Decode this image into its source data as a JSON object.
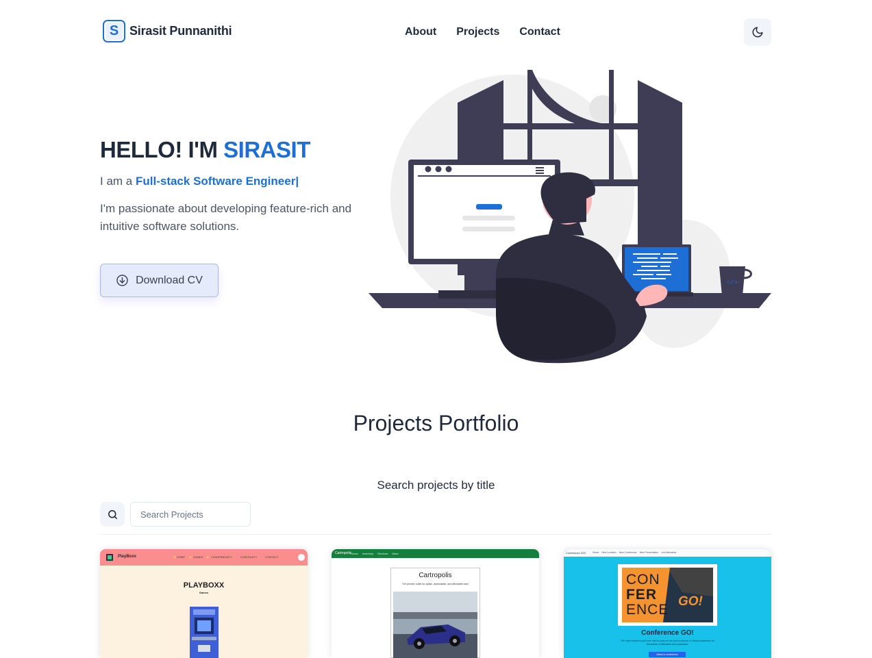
{
  "brand": {
    "logo_letter": "S",
    "name": "Sirasit Punnanithi"
  },
  "nav": {
    "links": [
      "About",
      "Projects",
      "Contact"
    ]
  },
  "theme_toggle": {
    "icon": "moon-icon"
  },
  "hero": {
    "greeting": "HELLO! I'M",
    "name": "SIRASIT",
    "role_prefix": "I am a",
    "role": "Full-stack Software Engineer|",
    "description": "I'm passionate about developing feature-rich and intuitive software solutions.",
    "cv_button": "Download CV",
    "cv_icon": "download-circle-icon"
  },
  "projects": {
    "title": "Projects Portfolio",
    "search_caption": "Search projects by title",
    "search_placeholder": "Search Projects",
    "search_icon": "search-icon",
    "cards": [
      {
        "preview_brand": "PlayBoxx",
        "preview_nav": [
          "HOME",
          "GAMES",
          "LEADERBOARD",
          "COMMUNITY",
          "CONTACT"
        ],
        "preview_title": "PLAYBOXX",
        "preview_subtitle": "Games"
      },
      {
        "preview_brand": "Cartropolis",
        "preview_nav": [
          "Home",
          "Inventory",
          "Services",
          "More"
        ],
        "preview_title": "Cartropolis",
        "preview_subtitle": "The premier outlet for stylish, dependable, and affordable cars!"
      },
      {
        "preview_brand": "Conference GO!",
        "preview_nav": [
          "Home",
          "New Location",
          "New Conference",
          "New Presentation",
          "List Attendees"
        ],
        "preview_logo_lines": [
          "CON",
          "FER",
          "ENCE",
          "GO!"
        ],
        "preview_title": "Conference GO!",
        "preview_subtitle": "The only resource you'll ever need to plan an run your in-person or virtual conference for thousands of attendees and presenters.",
        "preview_button": "Attend a conference"
      }
    ]
  },
  "colors": {
    "accent": "#1d6fd6",
    "text": "#1e293b",
    "art_dark": "#3f3d56",
    "art_skin": "#ffb6b6"
  }
}
